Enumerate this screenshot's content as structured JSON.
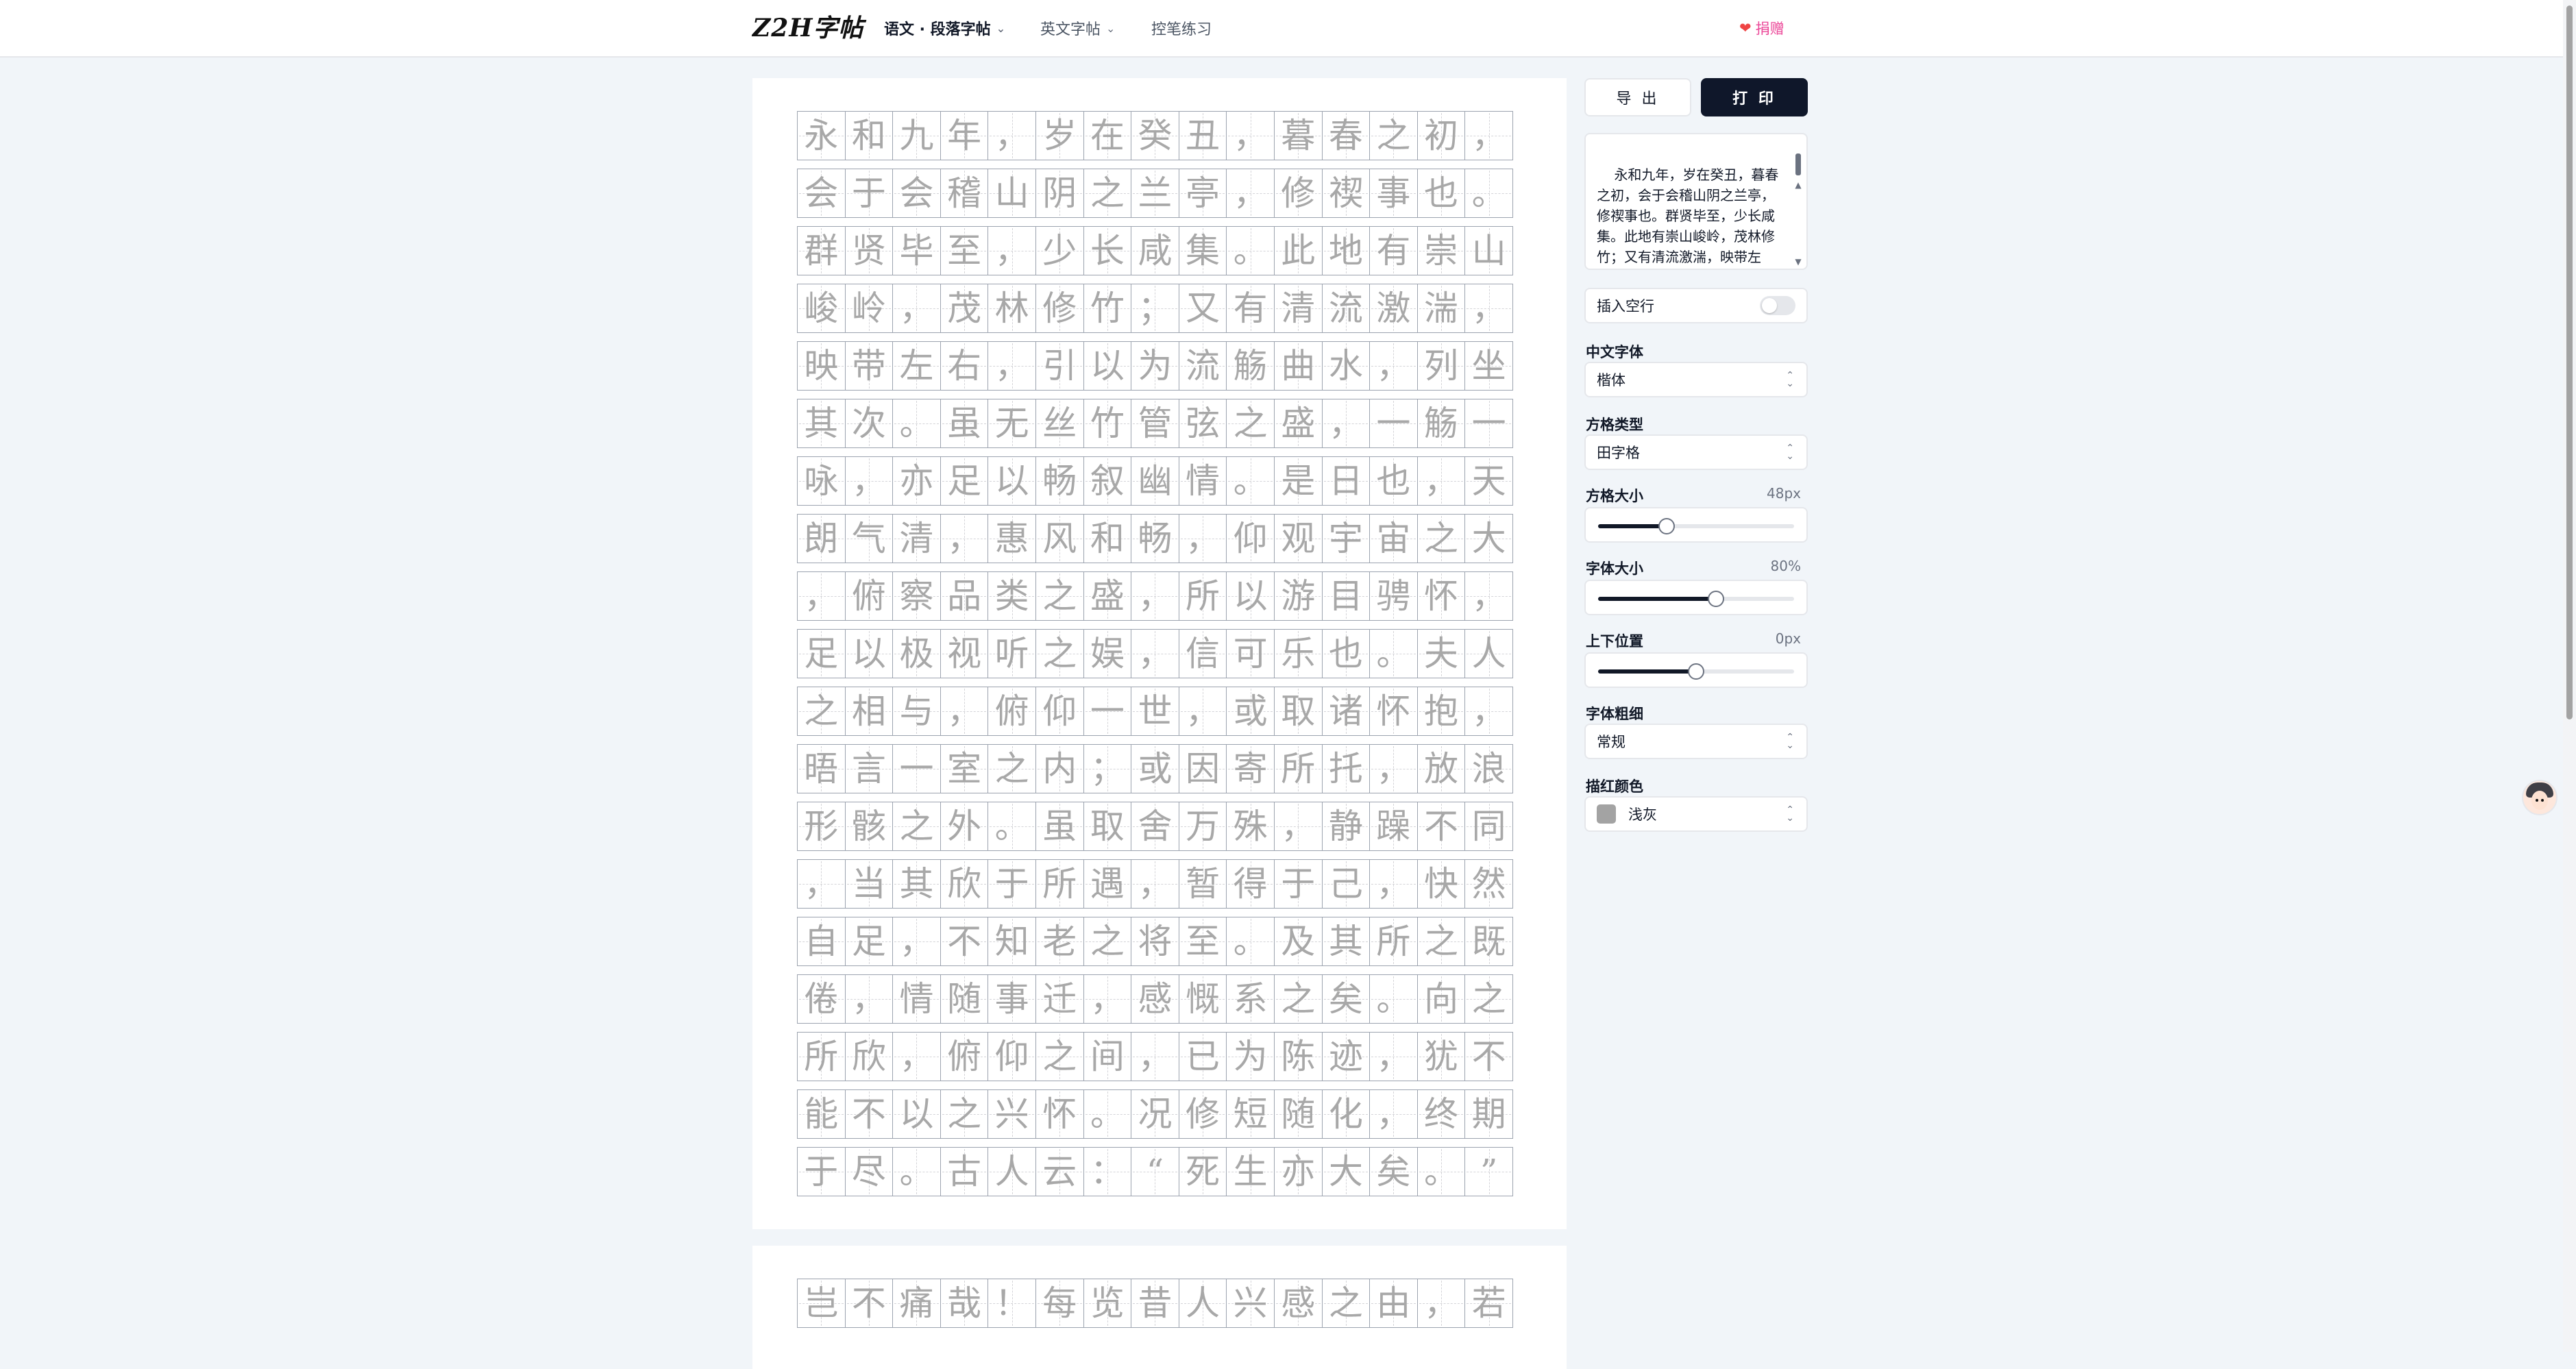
{
  "header": {
    "logo": "Z2H字帖",
    "nav": [
      {
        "label": "语文 · 段落字帖"
      },
      {
        "label": "英文字帖"
      },
      {
        "label": "控笔练习"
      }
    ],
    "donate": "捐赠"
  },
  "sheets": [
    {
      "rows": [
        "永和九年，岁在癸丑，暮春之初，",
        "会于会稽山阴之兰亭，修禊事也。",
        "群贤毕至，少长咸集。此地有崇山",
        "峻岭，茂林修竹；又有清流激湍，",
        "映带左右，引以为流觞曲水，列坐",
        "其次。虽无丝竹管弦之盛，一觞一",
        "咏，亦足以畅叙幽情。是日也，天",
        "朗气清，惠风和畅，仰观宇宙之大",
        "，俯察品类之盛，所以游目骋怀，",
        "足以极视听之娱，信可乐也。夫人",
        "之相与，俯仰一世，或取诸怀抱，",
        "晤言一室之内；或因寄所托，放浪",
        "形骸之外。虽取舍万殊，静躁不同",
        "，当其欣于所遇，暂得于己，快然",
        "自足，不知老之将至。及其所之既",
        "倦，情随事迁，感慨系之矣。向之",
        "所欣，俯仰之间，已为陈迹，犹不",
        "能不以之兴怀。况修短随化，终期",
        "于尽。古人云：“死生亦大矣。”"
      ]
    },
    {
      "rows": [
        "岂不痛哉！每览昔人兴感之由，若"
      ]
    }
  ],
  "panel": {
    "export_label": "导 出",
    "print_label": "打 印",
    "text_content": "永和九年，岁在癸丑，暮春之初，会于会稽山阴之兰亭，修禊事也。群贤毕至，少长咸集。此地有崇山峻岭，茂林修竹；又有清流激湍，映带左右，引以为流觞曲水，列坐其次。",
    "insert_blank_line": {
      "label": "插入空行",
      "enabled": false
    },
    "chinese_font": {
      "label": "中文字体",
      "value": "楷体"
    },
    "grid_type": {
      "label": "方格类型",
      "value": "田字格"
    },
    "grid_size": {
      "label": "方格大小",
      "value_text": "48px",
      "fraction": 0.35
    },
    "font_size": {
      "label": "字体大小",
      "value_text": "80%",
      "fraction": 0.6
    },
    "vertical_offset": {
      "label": "上下位置",
      "value_text": "0px",
      "fraction": 0.5
    },
    "font_weight": {
      "label": "字体粗细",
      "value": "常规"
    },
    "trace_color": {
      "label": "描红颜色",
      "value": "浅灰",
      "swatch": "#a3a3a3"
    }
  },
  "colors": {
    "accent": "#0f172a",
    "brand_pink": "#ec4899",
    "glyph_gray": "#a8a8a8",
    "grid_line": "#9ca3af"
  }
}
